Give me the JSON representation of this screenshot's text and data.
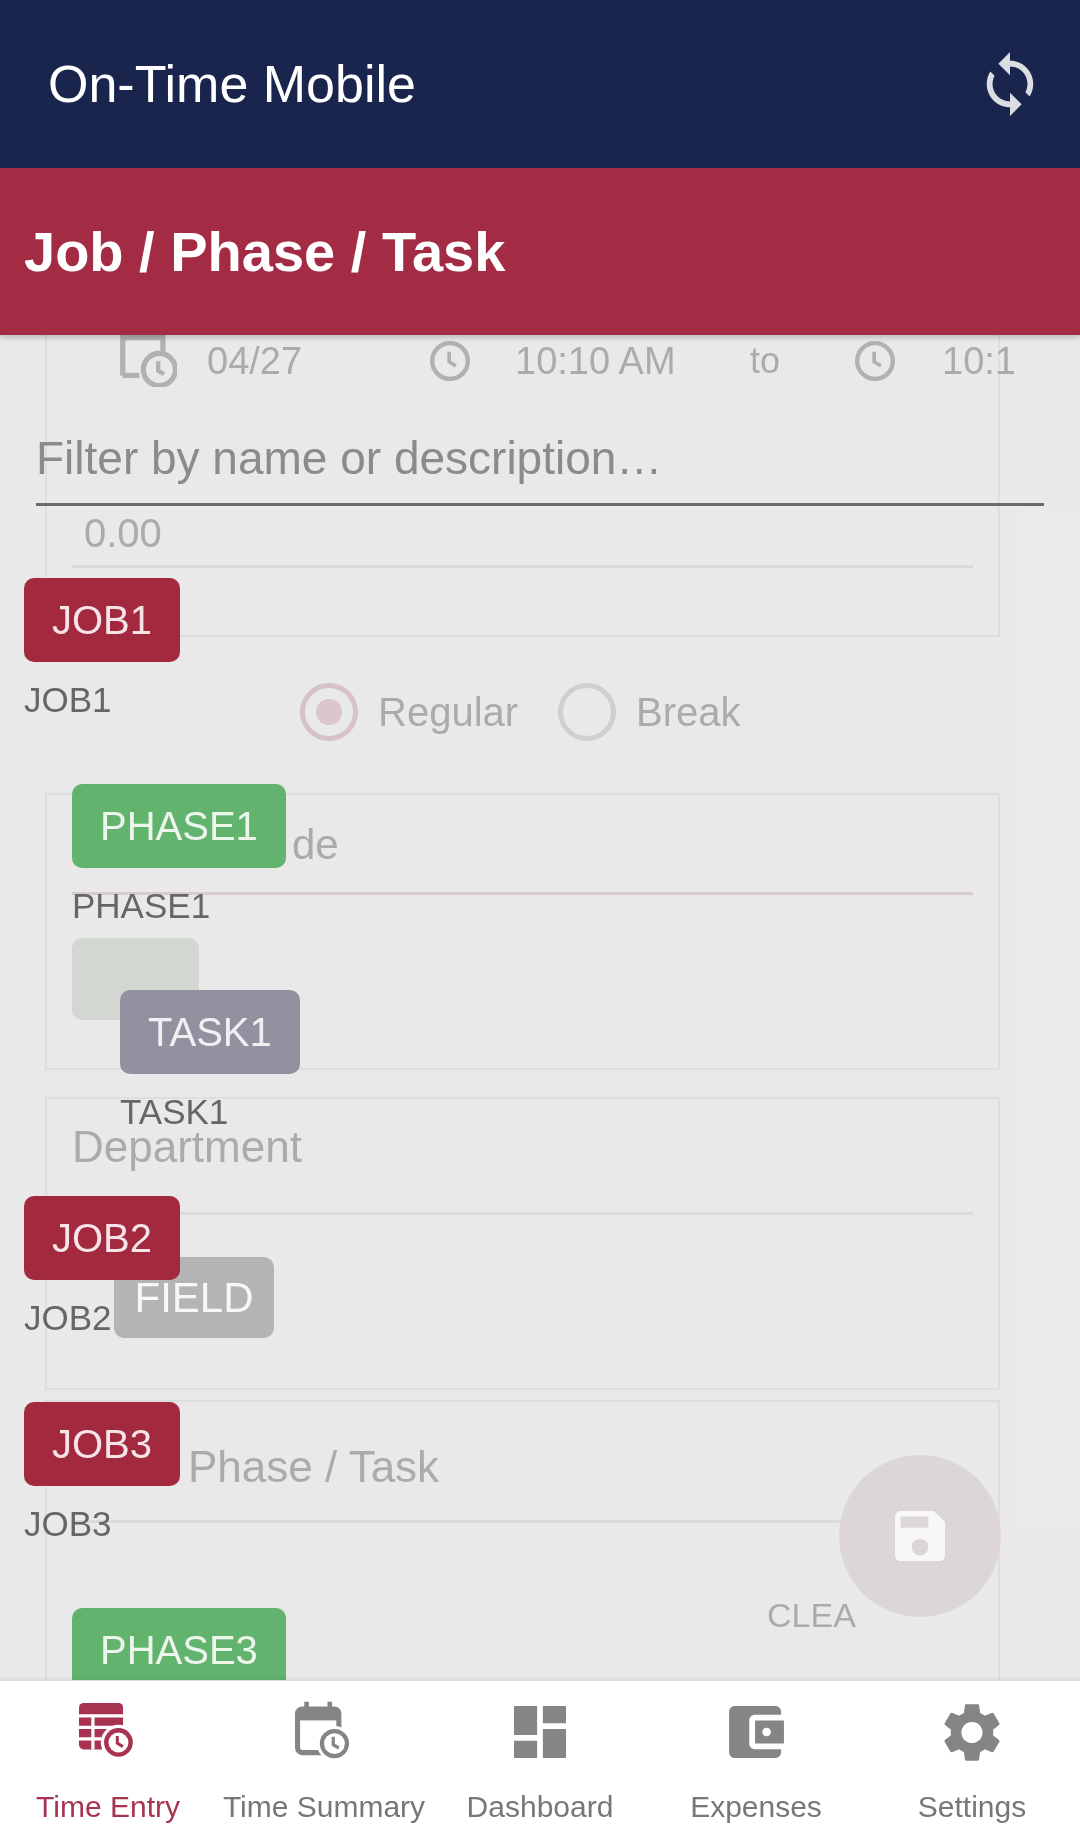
{
  "app_bar": {
    "title": "On-Time Mobile"
  },
  "section_bar": {
    "title": "Job / Phase / Task"
  },
  "time_entry_form": {
    "date": "04/27",
    "start_time": "10:10 AM",
    "separator": "to",
    "end_time": "10:1",
    "hours": "0.00",
    "entry_types": [
      {
        "label": "Regular",
        "selected": true
      },
      {
        "label": "Break",
        "selected": false
      }
    ],
    "pay_code_label": "de",
    "department_label": "Department",
    "department_value": "FIELD",
    "job_phase_task_label": "Phase / Task",
    "clear_button": "CLEA"
  },
  "picker": {
    "filter": {
      "placeholder": "Filter by name or description…"
    },
    "items": [
      {
        "kind": "job",
        "code": "JOB1",
        "name": "JOB1",
        "children": [
          {
            "kind": "phase",
            "code": "PHASE1",
            "name": "PHASE1",
            "children": [
              {
                "kind": "task",
                "code": "TASK1",
                "name": "TASK1"
              }
            ]
          }
        ]
      },
      {
        "kind": "job",
        "code": "JOB2",
        "name": "JOB2"
      },
      {
        "kind": "job",
        "code": "JOB3",
        "name": "JOB3",
        "children": [
          {
            "kind": "phase",
            "code": "PHASE3"
          }
        ]
      }
    ]
  },
  "bottom_nav": [
    {
      "label": "Time Entry",
      "selected": true
    },
    {
      "label": "Time Summary",
      "selected": false
    },
    {
      "label": "Dashboard",
      "selected": false
    },
    {
      "label": "Expenses",
      "selected": false
    },
    {
      "label": "Settings",
      "selected": false
    }
  ]
}
